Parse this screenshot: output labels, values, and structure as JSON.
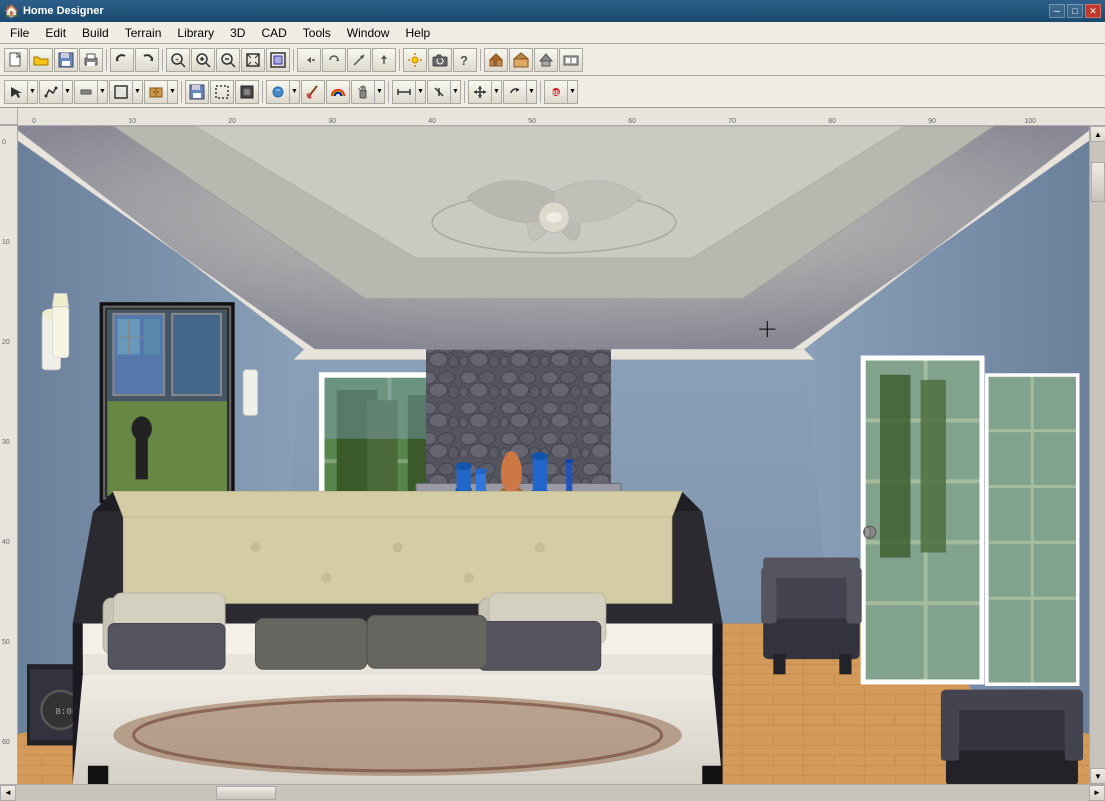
{
  "titlebar": {
    "title": "Home Designer",
    "icon": "🏠",
    "controls": {
      "minimize": "─",
      "maximize": "□",
      "close": "✕"
    }
  },
  "menubar": {
    "items": [
      "File",
      "Edit",
      "Build",
      "Terrain",
      "Library",
      "3D",
      "CAD",
      "Tools",
      "Window",
      "Help"
    ]
  },
  "toolbar1": {
    "buttons": [
      {
        "name": "new",
        "icon": "📄"
      },
      {
        "name": "open",
        "icon": "📂"
      },
      {
        "name": "save",
        "icon": "💾"
      },
      {
        "name": "print",
        "icon": "🖨"
      },
      {
        "name": "undo",
        "icon": "↩"
      },
      {
        "name": "redo",
        "icon": "↪"
      },
      {
        "name": "zoom-out-box",
        "icon": "🔍"
      },
      {
        "name": "zoom-in",
        "icon": "⊕"
      },
      {
        "name": "zoom-out",
        "icon": "⊖"
      },
      {
        "name": "fit-window",
        "icon": "⊡"
      },
      {
        "name": "zoom-to-fit",
        "icon": "⊞"
      },
      {
        "name": "pan",
        "icon": "✋"
      },
      {
        "name": "orbit",
        "icon": "↺"
      },
      {
        "name": "orbit2",
        "icon": "⊕"
      },
      {
        "name": "orbit3",
        "icon": "↗"
      },
      {
        "name": "mark",
        "icon": "◂"
      },
      {
        "name": "arrow-up",
        "icon": "△"
      },
      {
        "name": "lighting",
        "icon": "💡"
      },
      {
        "name": "camera",
        "icon": "📷"
      },
      {
        "name": "help-info",
        "icon": "?"
      },
      {
        "name": "sep1",
        "type": "sep"
      },
      {
        "name": "exterior",
        "icon": "🏠"
      },
      {
        "name": "interior",
        "icon": "🏡"
      },
      {
        "name": "roof",
        "icon": "⌂"
      },
      {
        "name": "foundation",
        "icon": "⌂"
      }
    ]
  },
  "toolbar2": {
    "buttons": [
      {
        "name": "select",
        "icon": "↖"
      },
      {
        "name": "polyline",
        "icon": "⌒"
      },
      {
        "name": "wall",
        "icon": "▬"
      },
      {
        "name": "room",
        "icon": "▦"
      },
      {
        "name": "cabinet",
        "icon": "🗄"
      },
      {
        "name": "save2",
        "icon": "💾"
      },
      {
        "name": "cad-detail",
        "icon": "⬜"
      },
      {
        "name": "smart-obj",
        "icon": "⬛"
      },
      {
        "name": "material",
        "icon": "🎨"
      },
      {
        "name": "paintbrush",
        "icon": "🖌"
      },
      {
        "name": "rainbow",
        "icon": "🌈"
      },
      {
        "name": "spray",
        "icon": "💧"
      },
      {
        "name": "dimension",
        "icon": "⟷"
      },
      {
        "name": "arrow-tools",
        "icon": "↗"
      },
      {
        "name": "move",
        "icon": "✛"
      },
      {
        "name": "rotate",
        "icon": "↺"
      },
      {
        "name": "rec",
        "icon": "⏺"
      }
    ]
  },
  "scene": {
    "description": "3D bedroom interior with fireplace, bed, and french doors"
  },
  "statusbar": {
    "text": ""
  }
}
